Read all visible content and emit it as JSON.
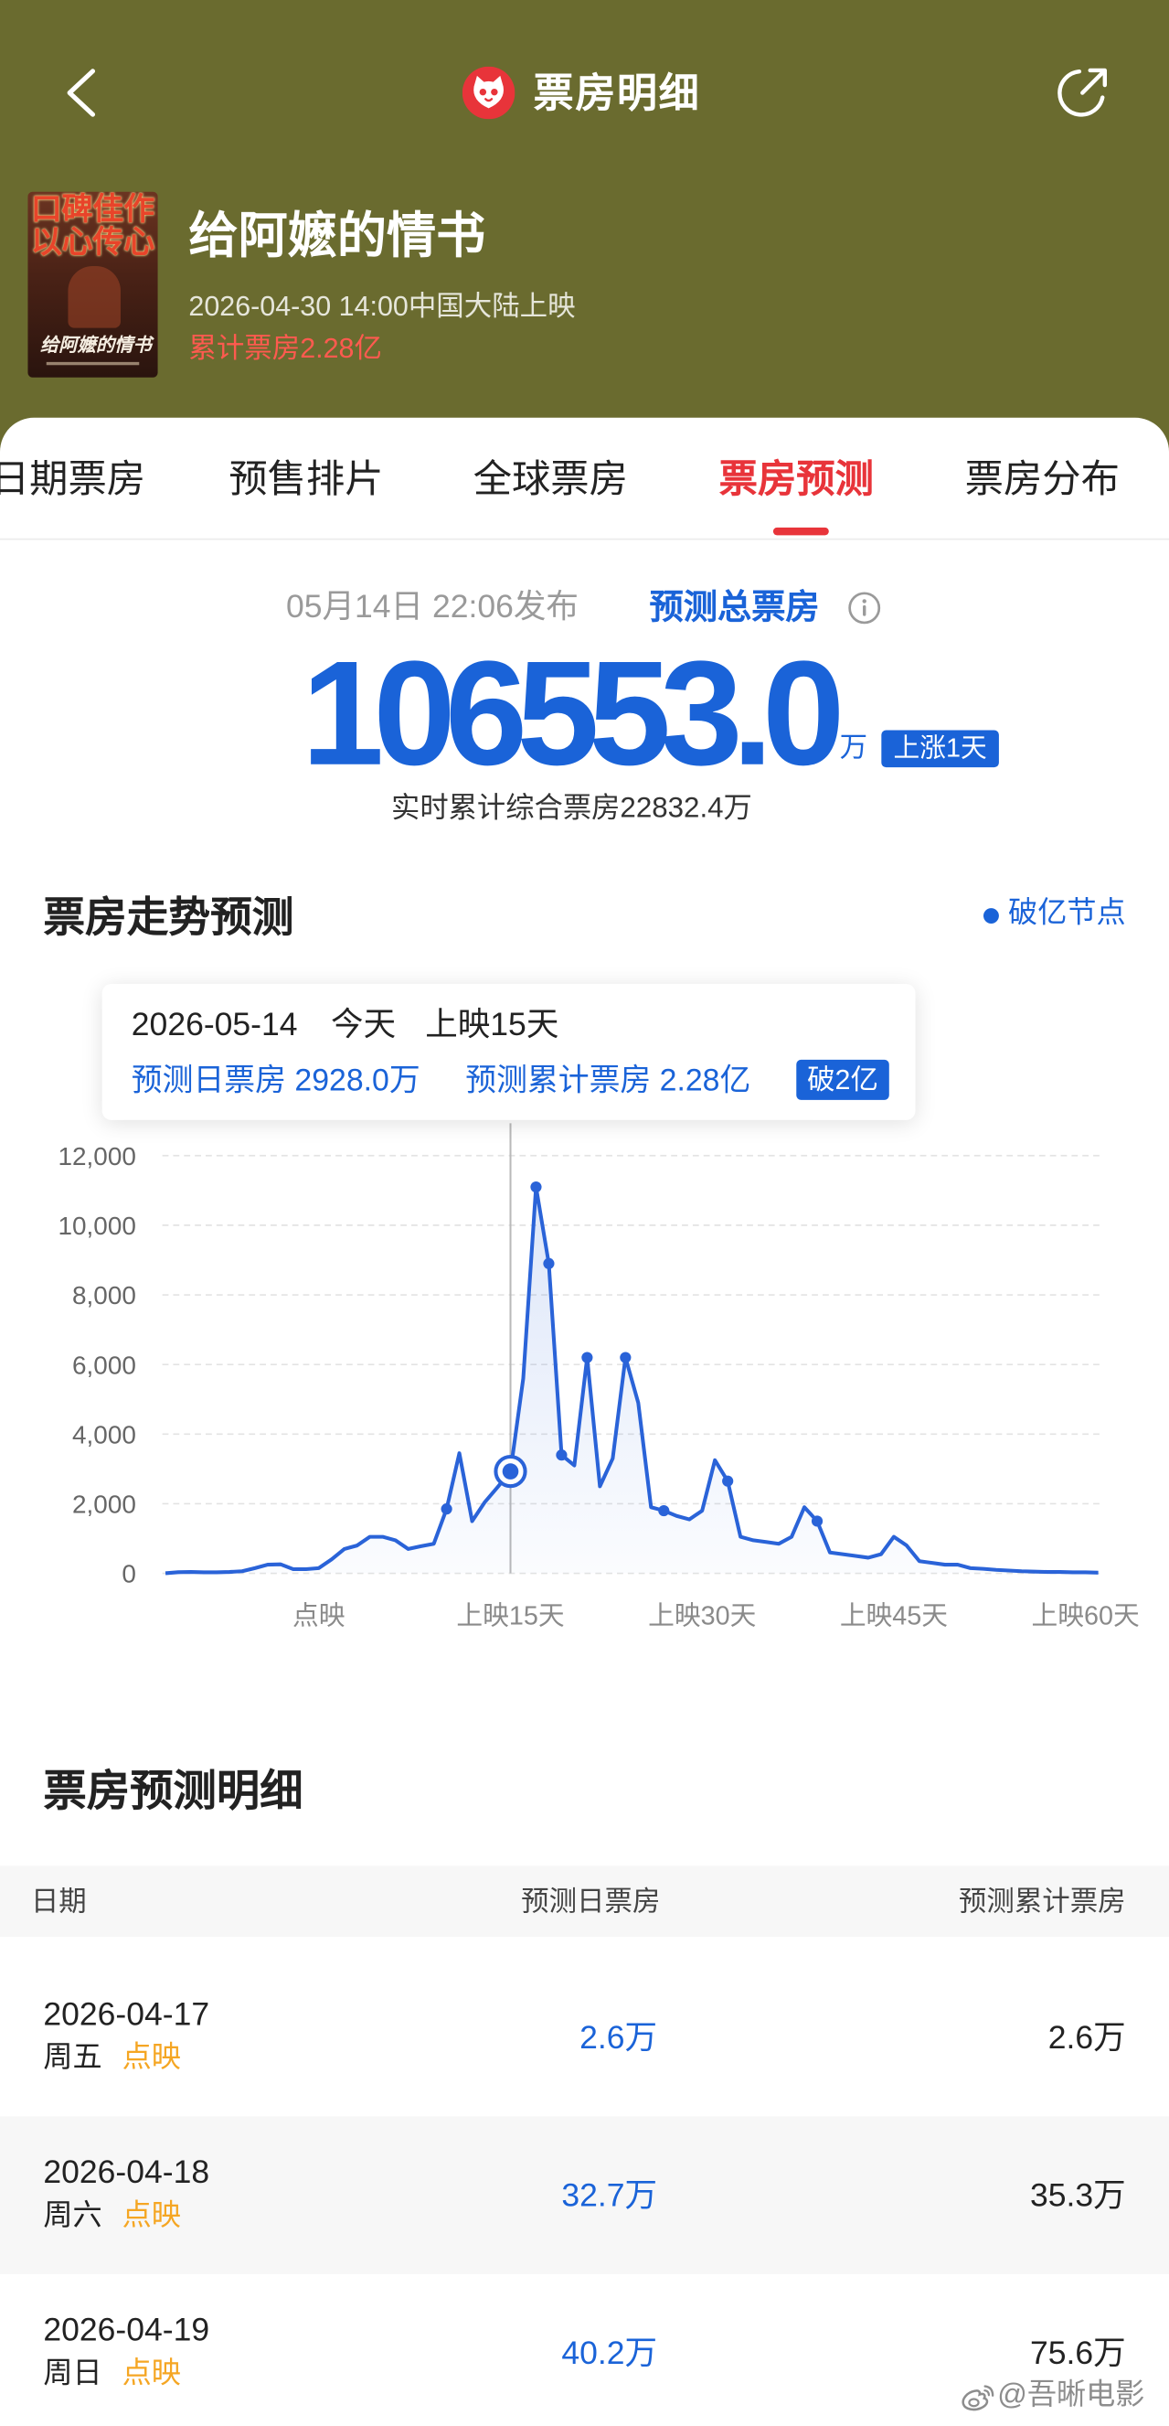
{
  "colors": {
    "header_bg": "#6a6b2f",
    "accent_red": "#e8343a",
    "cumulative_red": "#ff5a4f",
    "forecast_blue": "#1a63d8",
    "preview_tag": "#f5a623"
  },
  "nav": {
    "back_icon": "back-arrow-icon",
    "logo_icon": "maoyan-cat-logo-icon",
    "title": "票房明细",
    "share_icon": "share-icon"
  },
  "movie": {
    "poster": {
      "slogan_1": "口碑佳作",
      "slogan_2": "以心传心",
      "title": "给阿嬷的情书"
    },
    "title": "给阿嬷的情书",
    "release": "2026-04-30 14:00中国大陆上映",
    "cumulative": "累计票房2.28亿"
  },
  "tabs": [
    {
      "label": "日期票房",
      "active": false
    },
    {
      "label": "预售排片",
      "active": false
    },
    {
      "label": "全球票房",
      "active": false
    },
    {
      "label": "票房预测",
      "active": true
    },
    {
      "label": "票房分布",
      "active": false
    }
  ],
  "forecast": {
    "published": "05月14日 22:06发布",
    "label": "预测总票房",
    "info_icon": "info-icon",
    "total": "106553.0",
    "unit": "万",
    "badge": "上涨1天",
    "realtime": "实时累计综合票房22832.4万"
  },
  "trend": {
    "legend": "破亿节点",
    "tooltip": {
      "date": "2026-05-14",
      "today": "今天",
      "days": "上映15天",
      "daily": "预测日票房 2928.0万",
      "cumulative": "预测累计票房 2.28亿",
      "badge": "破2亿"
    }
  },
  "chart_data": {
    "type": "line",
    "title": "票房走势预测",
    "xlabel": "",
    "ylabel": "",
    "x": [
      "2026-04-17",
      "2026-04-18",
      "2026-04-19",
      "2026-04-20",
      "2026-04-21",
      "2026-04-22",
      "2026-04-23",
      "2026-04-24",
      "2026-04-25",
      "2026-04-26",
      "2026-04-27",
      "2026-04-28",
      "2026-04-29",
      "2026-04-30",
      "2026-05-01",
      "2026-05-02",
      "2026-05-03",
      "2026-05-04",
      "2026-05-05",
      "2026-05-06",
      "2026-05-07",
      "2026-05-08",
      "2026-05-09",
      "2026-05-10",
      "2026-05-11",
      "2026-05-12",
      "2026-05-13",
      "2026-05-14",
      "2026-05-15",
      "2026-05-16",
      "2026-05-17",
      "2026-05-18",
      "2026-05-19",
      "2026-05-20",
      "2026-05-21",
      "2026-05-22",
      "2026-05-23",
      "2026-05-24",
      "2026-05-25",
      "2026-05-26",
      "2026-05-27",
      "2026-05-28",
      "2026-05-29",
      "2026-05-30",
      "2026-05-31",
      "2026-06-01",
      "2026-06-02",
      "2026-06-03",
      "2026-06-04",
      "2026-06-05",
      "2026-06-06",
      "2026-06-07",
      "2026-06-08",
      "2026-06-09",
      "2026-06-10",
      "2026-06-11",
      "2026-06-12",
      "2026-06-13",
      "2026-06-14",
      "2026-06-15",
      "2026-06-16",
      "2026-06-17",
      "2026-06-18",
      "2026-06-19",
      "2026-06-20",
      "2026-06-21",
      "2026-06-22",
      "2026-06-23",
      "2026-06-24",
      "2026-06-25",
      "2026-06-26",
      "2026-06-27",
      "2026-06-28",
      "2026-06-29"
    ],
    "series": [
      {
        "name": "预测日票房",
        "color": "#2a63d8",
        "values": [
          2.6,
          32.7,
          40.2,
          30,
          30,
          40,
          60,
          150,
          250,
          260,
          120,
          120,
          150,
          400,
          700,
          800,
          1050,
          1050,
          950,
          700,
          780,
          850,
          1850,
          3450,
          1500,
          2050,
          2480,
          2928.0,
          5600,
          11100,
          8900,
          3400,
          3100,
          6200,
          2500,
          3300,
          6200,
          4900,
          1900,
          1800,
          1650,
          1550,
          1800,
          3250,
          2650,
          1050,
          950,
          900,
          850,
          1050,
          1900,
          1500,
          600,
          550,
          500,
          450,
          550,
          1050,
          800,
          350,
          300,
          250,
          250,
          150,
          130,
          100,
          80,
          60,
          50,
          40,
          40,
          30,
          30,
          20
        ]
      }
    ],
    "ylim": [
      0,
      12000
    ],
    "y_ticks": [
      {
        "value": 12000,
        "label": "12,000"
      },
      {
        "value": 10000,
        "label": "10,000"
      },
      {
        "value": 8000,
        "label": "8,000"
      },
      {
        "value": 6000,
        "label": "6,000"
      },
      {
        "value": 4000,
        "label": "4,000"
      },
      {
        "value": 2000,
        "label": "2,000"
      },
      {
        "value": 0,
        "label": "0"
      }
    ],
    "x_ticks": [
      {
        "x": "2026-04-29",
        "label": "点映"
      },
      {
        "x": "2026-05-14",
        "label": "上映15天"
      },
      {
        "x": "2026-05-29",
        "label": "上映30天"
      },
      {
        "x": "2026-06-13",
        "label": "上映45天"
      },
      {
        "x": "2026-06-28",
        "label": "上映60天"
      }
    ],
    "milestones": [
      "2026-05-09",
      "2026-05-16",
      "2026-05-17",
      "2026-05-18",
      "2026-05-20",
      "2026-05-23",
      "2026-05-26",
      "2026-05-31",
      "2026-06-07"
    ],
    "highlight": {
      "x": "2026-05-14",
      "value": 2928.0
    },
    "grid": true,
    "legend_position": "top-right"
  },
  "detail": {
    "title": "票房预测明细",
    "columns": [
      "日期",
      "预测日票房",
      "预测累计票房"
    ],
    "rows": [
      {
        "date": "2026-04-17",
        "weekday": "周五",
        "tag": "点映",
        "daily": "2.6万",
        "cumulative": "2.6万"
      },
      {
        "date": "2026-04-18",
        "weekday": "周六",
        "tag": "点映",
        "daily": "32.7万",
        "cumulative": "35.3万"
      },
      {
        "date": "2026-04-19",
        "weekday": "周日",
        "tag": "点映",
        "daily": "40.2万",
        "cumulative": "75.6万"
      }
    ]
  },
  "watermark": {
    "icon": "weibo-icon",
    "text": "@吾晰电影"
  }
}
